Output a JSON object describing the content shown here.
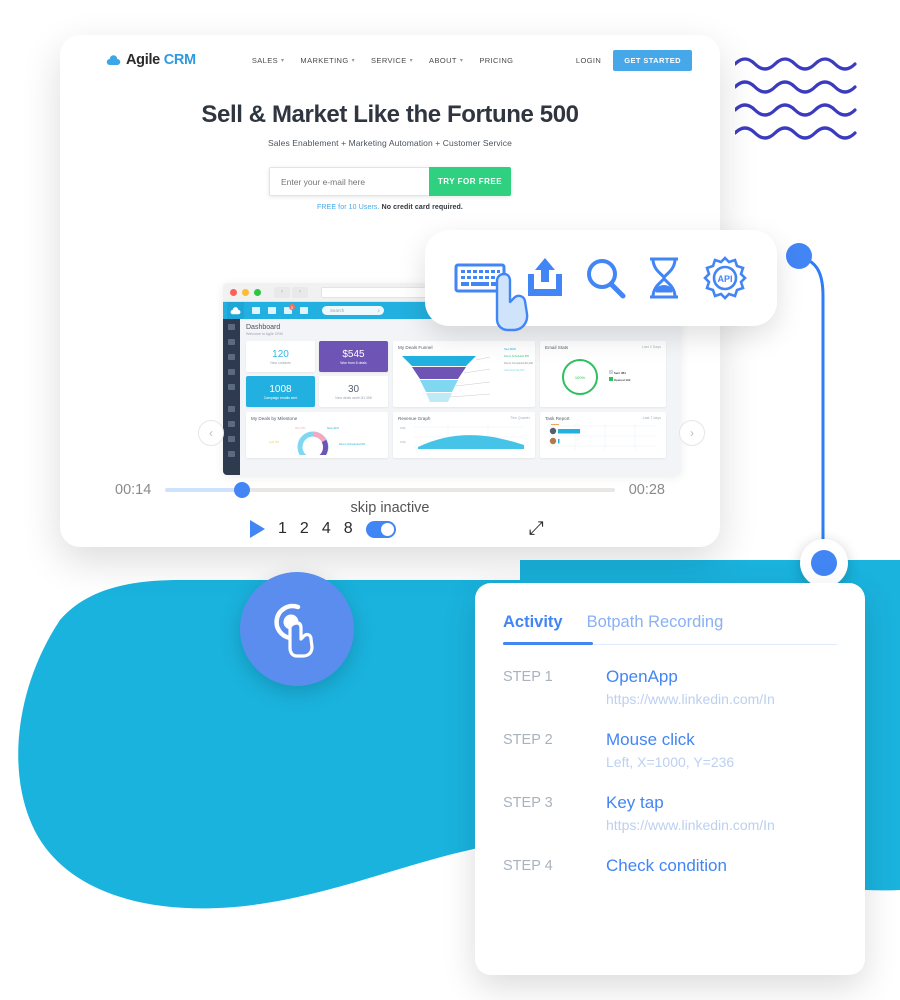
{
  "site": {
    "logo": {
      "name_dark": "Agile",
      "name_blue": "CRM",
      "icon": "cloud-icon"
    },
    "nav": [
      {
        "label": "SALES",
        "has_caret": true
      },
      {
        "label": "MARKETING",
        "has_caret": true
      },
      {
        "label": "SERVICE",
        "has_caret": true
      },
      {
        "label": "ABOUT",
        "has_caret": true
      },
      {
        "label": "PRICING",
        "has_caret": false
      }
    ],
    "login_label": "LOGIN",
    "get_started_label": "GET STARTED",
    "hero": {
      "headline": "Sell & Market Like the Fortune 500",
      "subhead": "Sales Enablement + Marketing Automation + Customer Service",
      "email_placeholder": "Enter your e-mail here",
      "email_value": "",
      "cta_label": "TRY FOR FREE",
      "note_link": "FREE for 10 Users.",
      "note_bold": "No credit card required."
    }
  },
  "browser_mock": {
    "url_value": "",
    "app_search_placeholder": "Search",
    "notification_count": "0",
    "dashboard": {
      "title": "Dashboard",
      "subtitle": "Welcome to Agile CRM",
      "kpis": [
        {
          "value": "120",
          "label": "New contacts",
          "style": "white"
        },
        {
          "value": "$545",
          "label": "Won from 8 deals",
          "style": "purple"
        },
        {
          "value": "1008",
          "label": "Campaign emails sent",
          "style": "cyan"
        },
        {
          "value": "30",
          "label": "New deals worth $1,358",
          "style": "white2"
        }
      ],
      "panels": [
        {
          "title": "My Deals Funnel",
          "meta": ""
        },
        {
          "title": "Email Stats",
          "meta": "Last 2 Days",
          "center_value": "100%"
        },
        {
          "title": "My Deals by Milestone",
          "meta": ""
        },
        {
          "title": "Revenue Graph",
          "meta": "This Quarter"
        },
        {
          "title": "Task Report",
          "meta": "Last 7 days"
        }
      ],
      "funnel_labels": [
        "New $600",
        "Demo Scheduled $50",
        "Demo Completed $1,200",
        "Interested $2,000"
      ],
      "milestone_labels": [
        "Won 8%",
        "New 44%",
        "Lost 5%",
        "Demo Scheduled 9%"
      ],
      "email_legend": [
        "Sent 384",
        "Opened 102"
      ],
      "revenue_ticks": [
        "200k",
        "100k"
      ]
    }
  },
  "player": {
    "current_time": "00:14",
    "total_time": "00:28",
    "progress_percent": 17,
    "skip_label": "skip inactive",
    "skip_enabled": true,
    "play_icon": "play-icon",
    "speeds": [
      "1",
      "2",
      "4",
      "8"
    ],
    "expand_icon": "expand-icon",
    "prev_icon": "chevron-left-icon",
    "next_icon": "chevron-right-icon"
  },
  "icon_toolbar": {
    "items": [
      {
        "icon": "keyboard-icon",
        "label": "Keyboard"
      },
      {
        "icon": "upload-icon",
        "label": "Upload"
      },
      {
        "icon": "search-icon",
        "label": "Search"
      },
      {
        "icon": "hourglass-icon",
        "label": "Wait"
      },
      {
        "icon": "api-gear-icon",
        "label": "API"
      }
    ],
    "cursor_icon": "hand-pointer-icon"
  },
  "click_badge": {
    "icon": "tap-click-icon"
  },
  "activity": {
    "tabs": [
      {
        "label": "Activity",
        "active": true
      },
      {
        "label": "Botpath Recording",
        "active": false
      }
    ],
    "steps": [
      {
        "label": "STEP 1",
        "title": "OpenApp",
        "detail": "https://www.linkedin.com/In"
      },
      {
        "label": "STEP 2",
        "title": "Mouse click",
        "detail": "Left, X=1000, Y=236"
      },
      {
        "label": "STEP 3",
        "title": "Key tap",
        "detail": "https://www.linkedin.com/In"
      },
      {
        "label": "STEP 4",
        "title": "Check condition",
        "detail": ""
      }
    ]
  },
  "decor": {
    "wave_color": "#3b3bbf",
    "blob_color": "#1ab3de",
    "accent_blue": "#4285f4",
    "brand_cyan": "#22b0e0",
    "green_cta": "#2fd07f"
  }
}
